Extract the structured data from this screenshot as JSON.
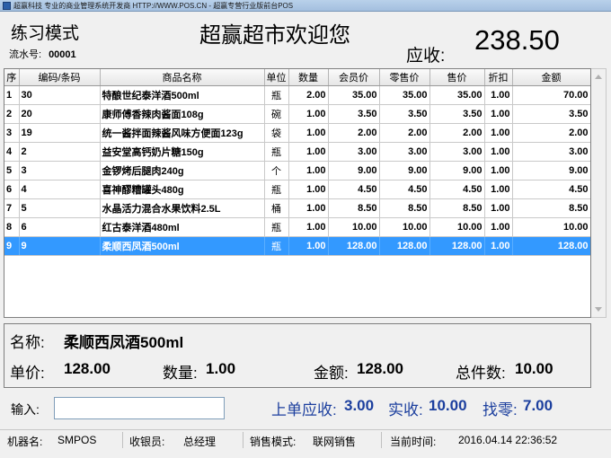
{
  "window": {
    "title": "超赢科技 专业的商业管理系统开发商 HTTP://WWW.POS.CN - 超赢专营行业版前台POS"
  },
  "header": {
    "mode": "练习模式",
    "serial_label": "流水号:",
    "serial_value": "00001",
    "welcome": "超赢超市欢迎您",
    "due_label": "应收:",
    "due_amount": "238.50"
  },
  "grid": {
    "columns": [
      "序",
      "编码/条码",
      "商品名称",
      "单位",
      "数量",
      "会员价",
      "零售价",
      "售价",
      "折扣",
      "金额"
    ],
    "rows": [
      {
        "seq": "1",
        "code": "30",
        "name": "特酿世纪泰洋酒500ml",
        "unit": "瓶",
        "qty": "2.00",
        "member": "35.00",
        "retail": "35.00",
        "price": "35.00",
        "discount": "1.00",
        "amount": "70.00"
      },
      {
        "seq": "2",
        "code": "20",
        "name": "康师傅香辣肉酱面108g",
        "unit": "碗",
        "qty": "1.00",
        "member": "3.50",
        "retail": "3.50",
        "price": "3.50",
        "discount": "1.00",
        "amount": "3.50"
      },
      {
        "seq": "3",
        "code": "19",
        "name": "统一酱拌面辣酱风味方便面123g",
        "unit": "袋",
        "qty": "1.00",
        "member": "2.00",
        "retail": "2.00",
        "price": "2.00",
        "discount": "1.00",
        "amount": "2.00"
      },
      {
        "seq": "4",
        "code": "2",
        "name": "益安堂高钙奶片糖150g",
        "unit": "瓶",
        "qty": "1.00",
        "member": "3.00",
        "retail": "3.00",
        "price": "3.00",
        "discount": "1.00",
        "amount": "3.00"
      },
      {
        "seq": "5",
        "code": "3",
        "name": "金锣烤后腿肉240g",
        "unit": "个",
        "qty": "1.00",
        "member": "9.00",
        "retail": "9.00",
        "price": "9.00",
        "discount": "1.00",
        "amount": "9.00"
      },
      {
        "seq": "6",
        "code": "4",
        "name": "喜神醪糟罐头480g",
        "unit": "瓶",
        "qty": "1.00",
        "member": "4.50",
        "retail": "4.50",
        "price": "4.50",
        "discount": "1.00",
        "amount": "4.50"
      },
      {
        "seq": "7",
        "code": "5",
        "name": "水晶活力混合水果饮料2.5L",
        "unit": "桶",
        "qty": "1.00",
        "member": "8.50",
        "retail": "8.50",
        "price": "8.50",
        "discount": "1.00",
        "amount": "8.50"
      },
      {
        "seq": "8",
        "code": "6",
        "name": "红古泰洋酒480ml",
        "unit": "瓶",
        "qty": "1.00",
        "member": "10.00",
        "retail": "10.00",
        "price": "10.00",
        "discount": "1.00",
        "amount": "10.00"
      },
      {
        "seq": "9",
        "code": "9",
        "name": "柔顺西凤酒500ml",
        "unit": "瓶",
        "qty": "1.00",
        "member": "128.00",
        "retail": "128.00",
        "price": "128.00",
        "discount": "1.00",
        "amount": "128.00",
        "selected": true
      }
    ]
  },
  "detail": {
    "name_label": "名称:",
    "name_value": "柔顺西凤酒500ml",
    "price_label": "单价:",
    "price_value": "128.00",
    "qty_label": "数量:",
    "qty_value": "1.00",
    "amount_label": "金额:",
    "amount_value": "128.00",
    "total_count_label": "总件数:",
    "total_count_value": "10.00"
  },
  "input": {
    "label": "输入:",
    "value": ""
  },
  "summary": {
    "prev_due_label": "上单应收:",
    "prev_due_value": "3.00",
    "paid_label": "实收:",
    "paid_value": "10.00",
    "change_label": "找零:",
    "change_value": "7.00"
  },
  "status": {
    "machine_label": "机器名:",
    "machine_value": "SMPOS",
    "cashier_label": "收银员:",
    "cashier_value": "总经理",
    "sales_mode_label": "销售模式:",
    "sales_mode_value": "联网销售",
    "time_label": "当前时间:",
    "time_value": "2016.04.14 22:36:52"
  },
  "colors": {
    "selected_row": "#3399ff",
    "summary_text": "#1c3f9e"
  }
}
